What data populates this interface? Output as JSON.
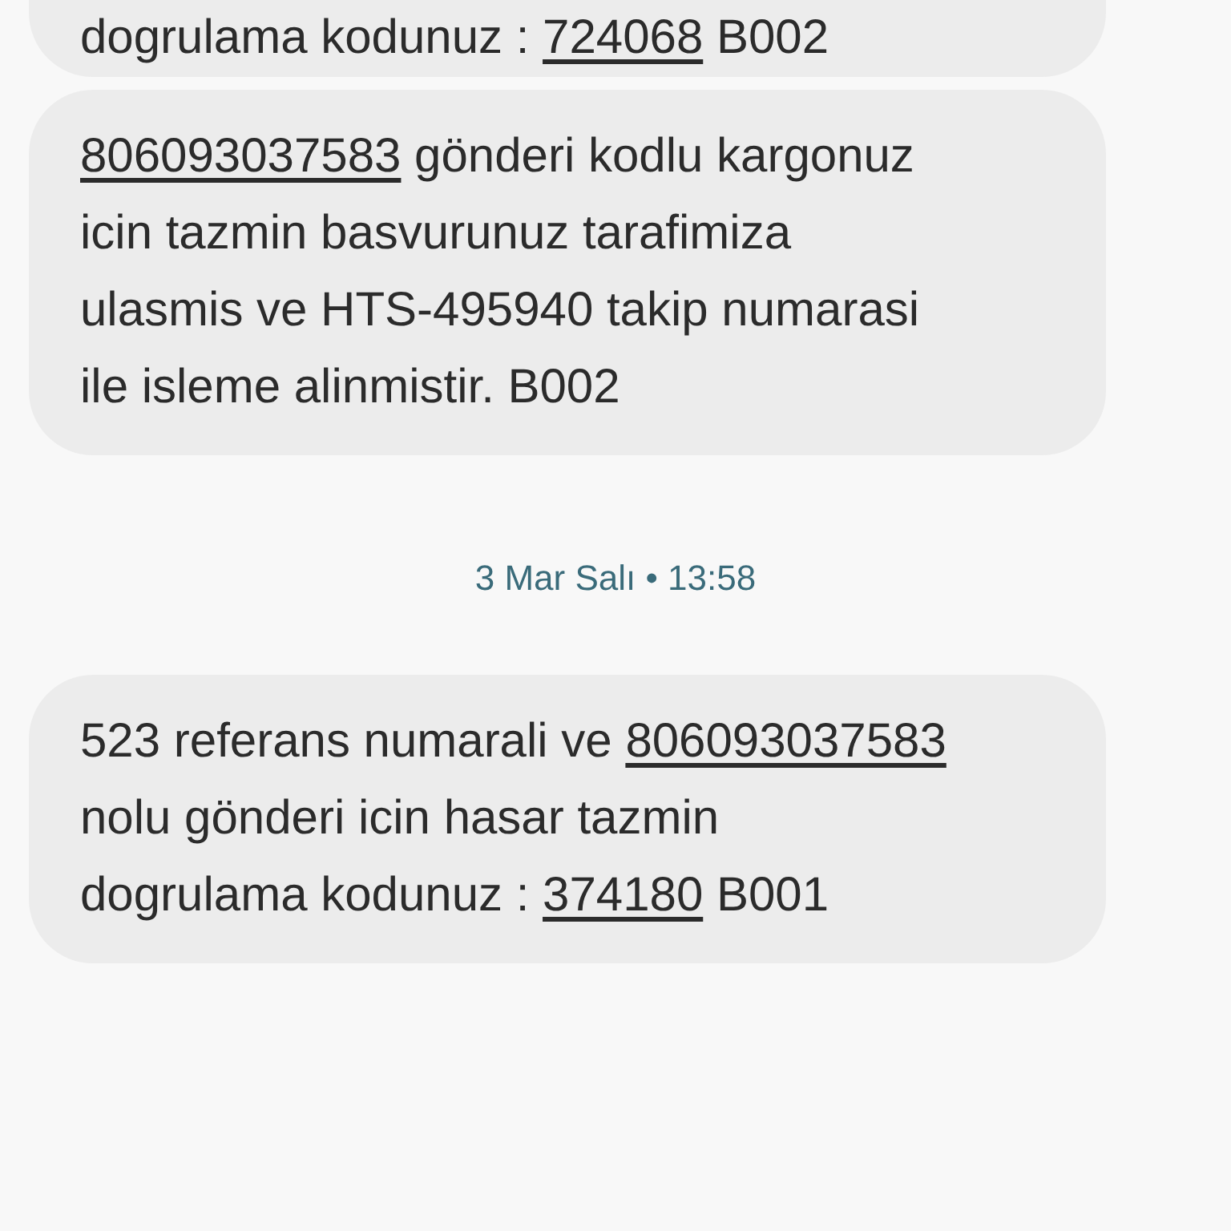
{
  "messages": [
    {
      "kind": "message",
      "lines": [
        [
          {
            "text": "dogrulama kodunuz : ",
            "link": false
          },
          {
            "text": "724068",
            "link": true
          },
          {
            "text": " B002",
            "link": false
          }
        ]
      ]
    },
    {
      "kind": "message",
      "lines": [
        [
          {
            "text": "806093037583",
            "link": true
          },
          {
            "text": " gönderi kodlu kargonuz",
            "link": false
          }
        ],
        [
          {
            "text": "icin tazmin basvurunuz tarafimiza",
            "link": false
          }
        ],
        [
          {
            "text": "ulasmis ve HTS-495940 takip numarasi",
            "link": false
          }
        ],
        [
          {
            "text": "ile isleme alinmistir. B002",
            "link": false
          }
        ]
      ]
    },
    {
      "kind": "timestamp",
      "text": "3 Mar Salı • 13:58"
    },
    {
      "kind": "message",
      "lines": [
        [
          {
            "text": "523 referans numarali ve ",
            "link": false
          },
          {
            "text": "806093037583",
            "link": true
          }
        ],
        [
          {
            "text": "nolu gönderi icin hasar tazmin",
            "link": false
          }
        ],
        [
          {
            "text": "dogrulama kodunuz : ",
            "link": false
          },
          {
            "text": "374180",
            "link": true
          },
          {
            "text": " B001",
            "link": false
          }
        ]
      ]
    }
  ]
}
